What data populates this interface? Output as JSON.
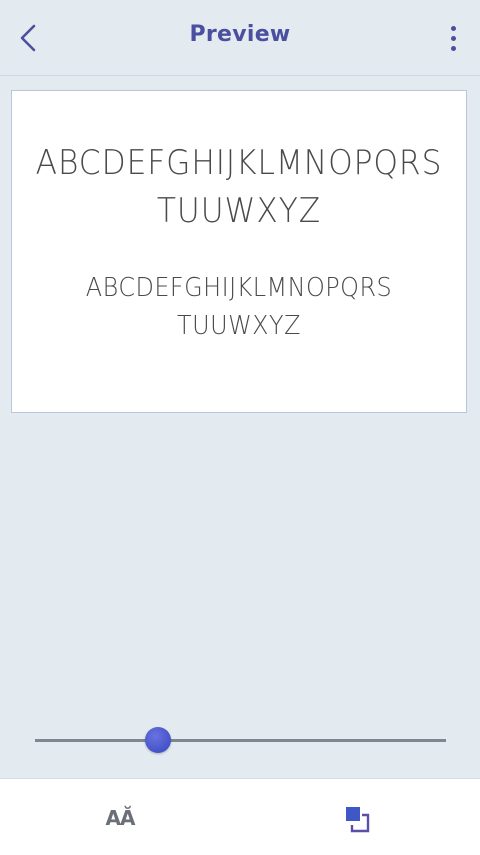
{
  "header": {
    "title": "Preview",
    "back_icon": "chevron-left-icon",
    "menu_icon": "more-vertical-icon"
  },
  "preview": {
    "large_line1": "ABCDEFGHIJKLMNOPQRS",
    "large_line2": "TUUWXYZ",
    "small_line1": "ABCDEFGHIJKLMNOPQRS",
    "small_line2": "TUUWXYZ"
  },
  "slider": {
    "value": 0.3
  },
  "bottom_bar": {
    "font_button_label": "AĂ",
    "font_icon": "font-size-icon",
    "layer_icon": "layer-icon"
  },
  "colors": {
    "accent": "#4b4f9f",
    "slider_thumb": "#4a58cf",
    "track": "#7f878e",
    "background": "#e3ebf0"
  }
}
